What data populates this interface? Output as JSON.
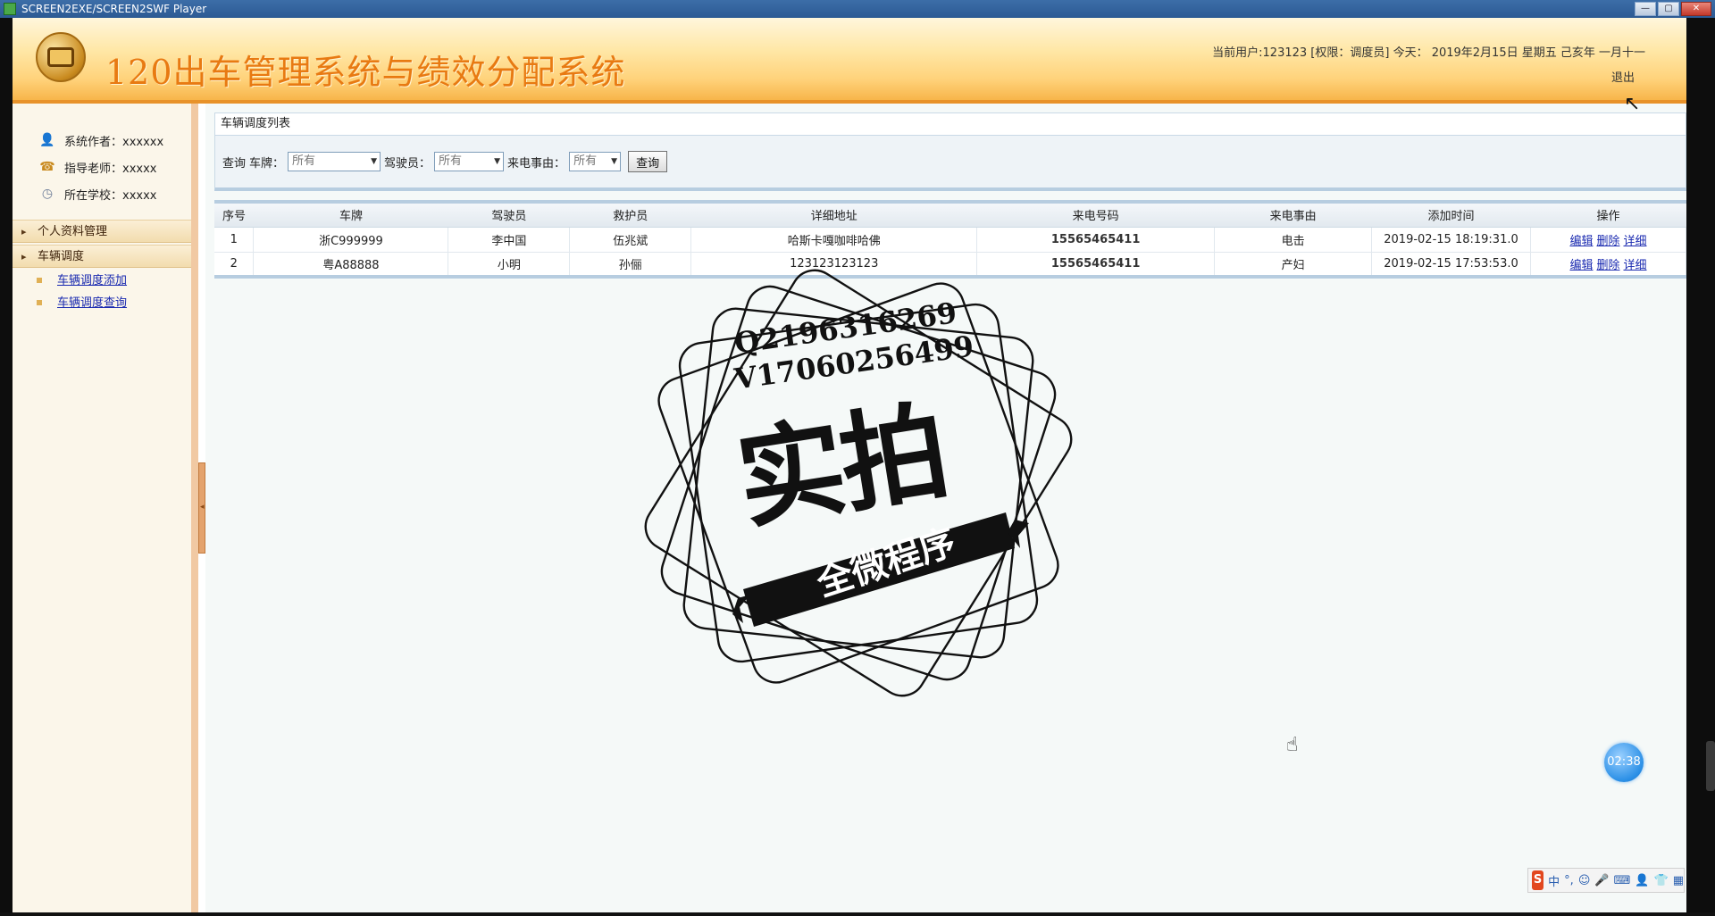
{
  "window": {
    "title": "SCREEN2EXE/SCREEN2SWF Player",
    "controls": [
      "—",
      "▢",
      "✕"
    ]
  },
  "header": {
    "system_title": "120出车管理系统与绩效分配系统",
    "user_info": "当前用户:123123 [权限：调度员] 今天： 2019年2月15日 星期五 己亥年 一月十一",
    "logout": "退出"
  },
  "sidebar": {
    "info": [
      {
        "icon": "person-icon",
        "text": "系统作者：xxxxxx"
      },
      {
        "icon": "phone-icon",
        "text": "指导老师：xxxxx"
      },
      {
        "icon": "clock-icon",
        "text": "所在学校：xxxxx"
      }
    ],
    "menus": [
      {
        "label": "个人资料管理",
        "items": []
      },
      {
        "label": "车辆调度",
        "items": [
          "车辆调度添加",
          "车辆调度查询"
        ]
      }
    ]
  },
  "main": {
    "panel_title": "车辆调度列表",
    "search": {
      "query_label": "查询",
      "plate_label": "车牌：",
      "plate_value": "所有",
      "driver_label": "驾驶员：",
      "driver_value": "所有",
      "reason_label": "来电事由：",
      "reason_value": "所有",
      "button": "查询"
    },
    "table": {
      "columns": [
        "序号",
        "车牌",
        "驾驶员",
        "救护员",
        "详细地址",
        "来电号码",
        "来电事由",
        "添加时间",
        "操作"
      ],
      "rows": [
        {
          "no": "1",
          "plate": "浙C999999",
          "driver": "李中国",
          "rescuer": "伍兆斌",
          "address": "哈斯卡嘎咖啡哈佛",
          "phone": "15565465411",
          "reason": "电击",
          "time": "2019-02-15 18:19:31.0"
        },
        {
          "no": "2",
          "plate": "粤A88888",
          "driver": "小明",
          "rescuer": "孙俪",
          "address": "123123123123",
          "phone": "15565465411",
          "reason": "产妇",
          "time": "2019-02-15 17:53:53.0"
        }
      ],
      "actions": [
        "编辑",
        "删除",
        "详细"
      ]
    }
  },
  "watermark": {
    "line1": "Q2196316269",
    "line2": "V17060256499",
    "big": "实拍",
    "ribbon": "全微程序"
  },
  "overlay": {
    "timer": "02:38",
    "ime_logo": "S",
    "ime_items": [
      "中",
      "°,",
      "☺",
      "🎤",
      "⌨",
      "👤",
      "👕",
      "▦"
    ]
  },
  "colors": {
    "title_orange": "#e87a12",
    "link_blue": "#1a2ab0",
    "header_band": "#f7b54a"
  }
}
